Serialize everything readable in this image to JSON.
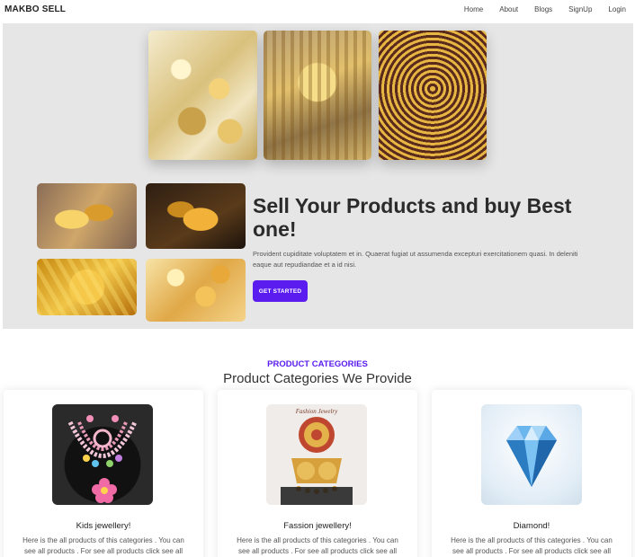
{
  "navbar": {
    "brand": "MAKBO SELL",
    "links": [
      "Home",
      "About",
      "Blogs",
      "SignUp",
      "Login"
    ]
  },
  "hero": {
    "title": "Sell Your Products and buy Best one!",
    "text": "Provident cupiditate voluptatem et in. Quaerat fugiat ut assumenda excepturi exercitationem quasi. In deleniti eaque aut repudiandae et a id nisi.",
    "cta": "GET STARTED"
  },
  "categories": {
    "kicker": "PRODUCT CATEGORIES",
    "title": "Product Categories We Provide",
    "items": [
      {
        "title": "Kids jewellery!",
        "text": "Here is the all products of this categories . You can see all products . For see all products click see all"
      },
      {
        "title": "Fassion jewellery!",
        "text": "Here is the all products of this categories . You can see all products . For see all products click see all"
      },
      {
        "title": "Diamond!",
        "text": "Here is the all products of this categories . You can see all products . For see all products click see all"
      }
    ],
    "fashion_image_caption": "Fashion Jewelry"
  }
}
